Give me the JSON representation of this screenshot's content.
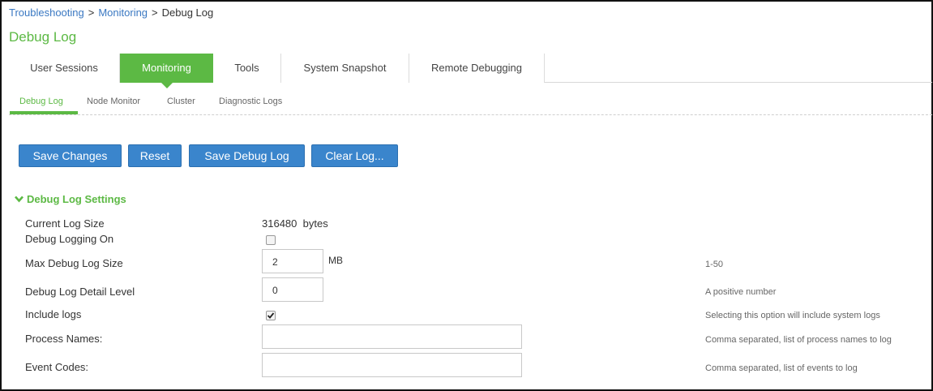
{
  "breadcrumb": {
    "items": [
      "Troubleshooting",
      "Monitoring"
    ],
    "current": "Debug Log",
    "separator": ">"
  },
  "page_title": "Debug Log",
  "tabs": [
    {
      "label": "User Sessions",
      "active": false
    },
    {
      "label": "Monitoring",
      "active": true
    },
    {
      "label": "Tools",
      "active": false
    },
    {
      "label": "System Snapshot",
      "active": false
    },
    {
      "label": "Remote Debugging",
      "active": false
    }
  ],
  "subtabs": [
    {
      "label": "Debug Log",
      "active": true
    },
    {
      "label": "Node Monitor",
      "active": false
    },
    {
      "label": "Cluster",
      "active": false
    },
    {
      "label": "Diagnostic Logs",
      "active": false
    }
  ],
  "toolbar": {
    "save_changes": "Save Changes",
    "reset": "Reset",
    "save_debug_log": "Save Debug Log",
    "clear_log": "Clear Log..."
  },
  "section": {
    "title": "Debug Log Settings",
    "expanded": true
  },
  "fields": {
    "current_log_size": {
      "label": "Current Log Size",
      "value": "316480",
      "unit": "bytes"
    },
    "debug_logging_on": {
      "label": "Debug Logging On",
      "checked": false
    },
    "max_debug_log_size": {
      "label": "Max Debug Log Size",
      "value": "2",
      "unit": "MB",
      "hint": "1-50"
    },
    "detail_level": {
      "label": "Debug Log Detail Level",
      "value": "0",
      "hint": "A positive number"
    },
    "include_logs": {
      "label": "Include logs",
      "checked": true,
      "hint": "Selecting this option will include system logs"
    },
    "process_names": {
      "label": "Process Names:",
      "value": "",
      "hint": "Comma separated, list of process names to log"
    },
    "event_codes": {
      "label": "Event Codes:",
      "value": "",
      "hint": "Comma separated, list of events to log"
    }
  },
  "colors": {
    "accent_green": "#5cb944",
    "button_blue": "#3a85cc",
    "link_blue": "#3a78c2"
  }
}
